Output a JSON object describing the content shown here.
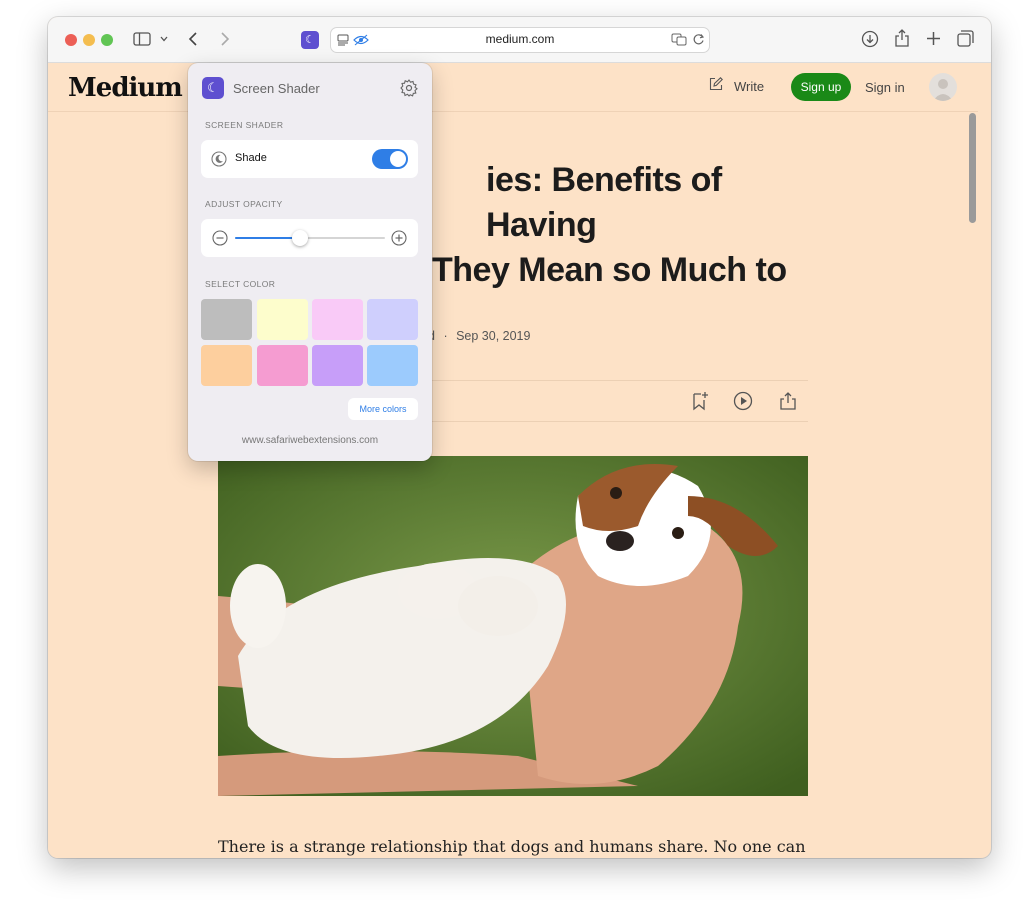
{
  "browser": {
    "address": "medium.com",
    "traffic_lights": {
      "close": "#ec5f56",
      "minimize": "#f4bd4f",
      "maximize": "#61c554"
    }
  },
  "site": {
    "brand": "Medium",
    "write_label": "Write",
    "signup_label": "Sign up",
    "signin_label": "Sign in",
    "title_line1": "ies: Benefits of Having",
    "title_line2": "They Mean so Much to",
    "meta_prefix": "d",
    "date": "Sep 30, 2019",
    "body_first_line": "There is a strange relationship that dogs and humans share. No one can",
    "background_color": "#fde2c7",
    "accent_color": "#1a8917"
  },
  "popup": {
    "title": "Screen Shader",
    "section_shader": "SCREEN SHADER",
    "shade_label": "Shade",
    "shade_on": true,
    "section_opacity": "ADJUST OPACITY",
    "opacity_fraction": 0.43,
    "section_color": "SELECT COLOR",
    "swatches": [
      "#bdbdbd",
      "#fdfdcc",
      "#f9caf7",
      "#cfcffd",
      "#fdcf9e",
      "#f59cd1",
      "#c79ef9",
      "#9ccbfd"
    ],
    "more_colors_label": "More colors",
    "footer": "www.safariwebextensions.com",
    "toggle_color": "#2f7ee6"
  }
}
